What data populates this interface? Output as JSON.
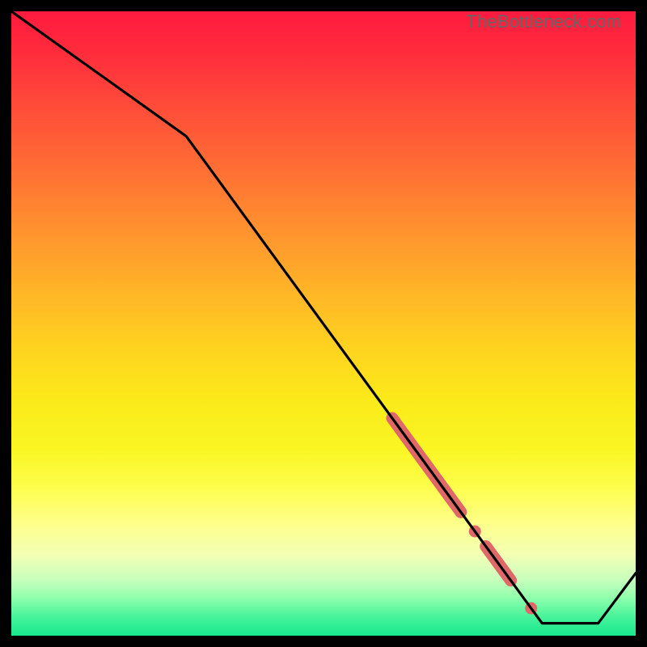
{
  "watermark": "TheBottleneck.com",
  "colors": {
    "line": "#000000",
    "highlight": "#e06868",
    "gradient_top": "#ff1a3f",
    "gradient_bottom": "#17e88e",
    "frame": "#000000"
  },
  "chart_data": {
    "type": "line",
    "title": "",
    "xlabel": "",
    "ylabel": "",
    "xlim": [
      0,
      100
    ],
    "ylim": [
      0,
      100
    ],
    "x": [
      0,
      28,
      85,
      94,
      100
    ],
    "values": [
      100,
      80,
      2,
      2,
      10
    ],
    "highlight_segments": [
      {
        "x_start": 61,
        "x_end": 72,
        "thickness": "thick"
      },
      {
        "x_start": 74,
        "x_end": 74.5,
        "thickness": "dot"
      },
      {
        "x_start": 76,
        "x_end": 80,
        "thickness": "thick"
      },
      {
        "x_start": 83,
        "x_end": 83.5,
        "thickness": "dot"
      }
    ]
  }
}
